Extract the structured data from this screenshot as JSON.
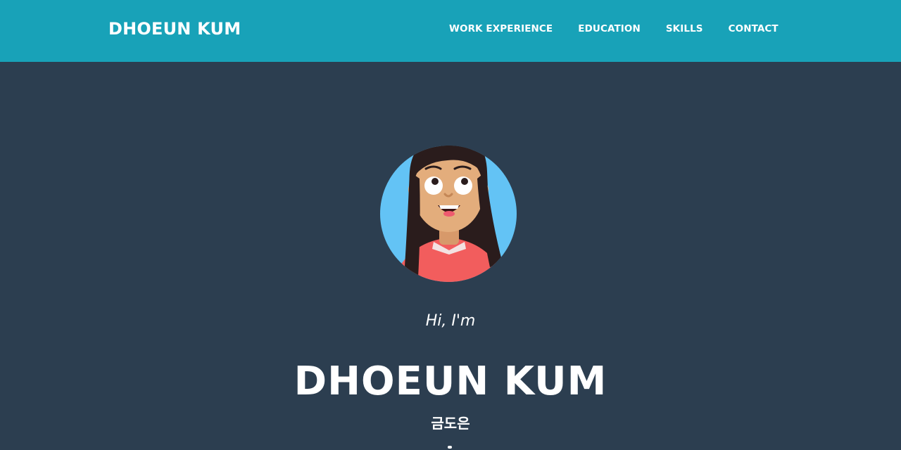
{
  "navbar": {
    "brand": "DHOEUN KUM",
    "links": [
      {
        "label": "WORK EXPERIENCE"
      },
      {
        "label": "EDUCATION"
      },
      {
        "label": "SKILLS"
      },
      {
        "label": "CONTACT"
      }
    ],
    "background": "#18a2b8"
  },
  "masthead": {
    "greeting": "Hi, I'm",
    "name": "DHOEUN KUM",
    "korean_name": "금도은",
    "background": "#2c3e50",
    "avatar_icon": "cartoon-girl-avatar"
  }
}
